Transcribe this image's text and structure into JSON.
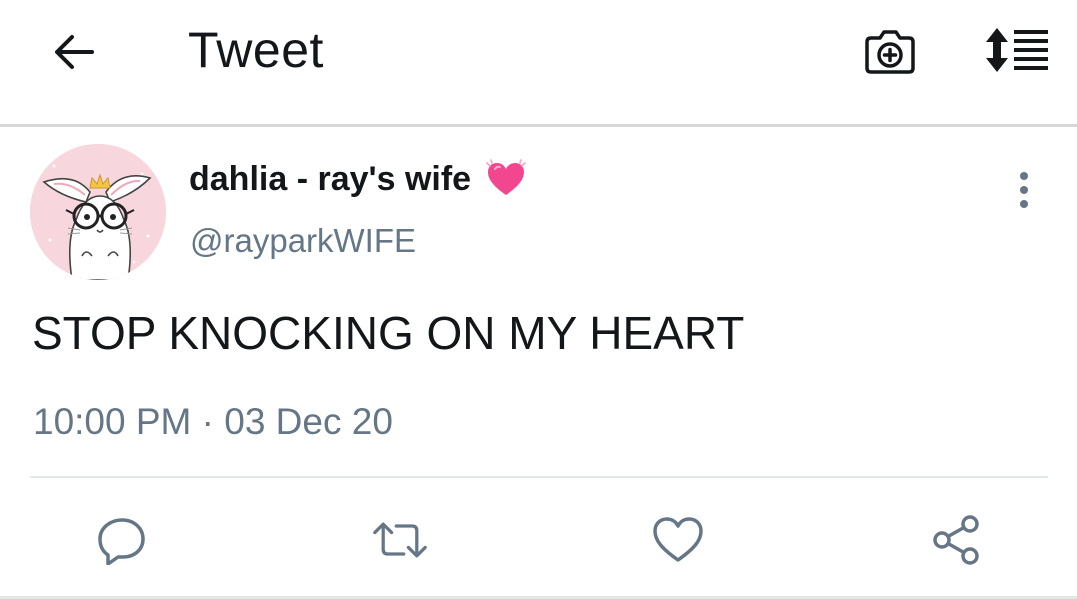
{
  "header": {
    "title": "Tweet",
    "back_icon": "arrow-left-icon",
    "camera_icon": "camera-plus-icon",
    "sort_icon": "sort-list-icon"
  },
  "tweet": {
    "display_name": "dahlia - ray's wife",
    "name_emoji": "sparkling-heart-emoji",
    "handle": "@rayparkWIFE",
    "text": "STOP KNOCKING ON MY HEART",
    "timestamp": "10:00 PM · 03 Dec 20",
    "avatar": "bunny-with-glasses-avatar",
    "more_icon": "vertical-dots-icon"
  },
  "actions": [
    {
      "name": "reply",
      "icon": "reply-icon"
    },
    {
      "name": "retweet",
      "icon": "retweet-icon"
    },
    {
      "name": "like",
      "icon": "heart-icon"
    },
    {
      "name": "share",
      "icon": "share-icon"
    }
  ],
  "colors": {
    "primary_text": "#14171a",
    "secondary_text": "#657786",
    "icon_gray": "#657786",
    "divider": "#e1e8ed",
    "avatar_bg": "#f7d6dd",
    "emoji_pink": "#f2478f"
  }
}
